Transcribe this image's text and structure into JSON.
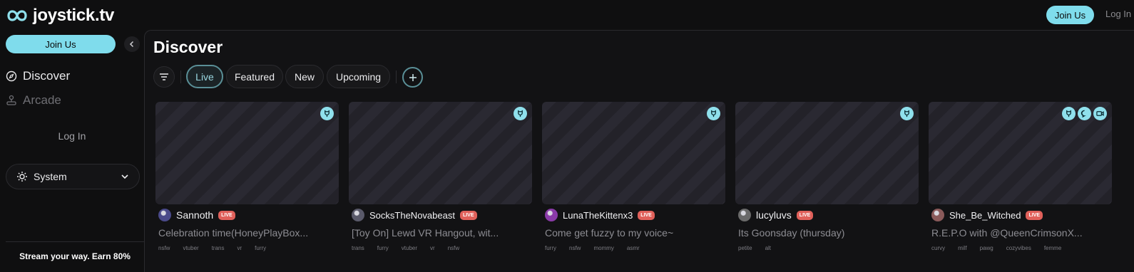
{
  "header": {
    "logo_text": "joystick.tv",
    "join_label": "Join Us",
    "login_label": "Log In"
  },
  "sidebar": {
    "join_label": "Join Us",
    "nav": [
      {
        "label": "Discover",
        "icon": "compass-icon"
      },
      {
        "label": "Arcade",
        "icon": "joystick-icon"
      }
    ],
    "login_label": "Log In",
    "theme_value": "System",
    "promo_text": "Stream your way. Earn 80%"
  },
  "main": {
    "title": "Discover",
    "tabs": [
      {
        "label": "Live",
        "active": true
      },
      {
        "label": "Featured",
        "active": false
      },
      {
        "label": "New",
        "active": false
      },
      {
        "label": "Upcoming",
        "active": false
      }
    ]
  },
  "streams": [
    {
      "name": "Sannoth",
      "live_label": "LIVE",
      "title": "Celebration time(HoneyPlayBox...",
      "tags": [
        "nsfw",
        "vtuber",
        "trans",
        "vr",
        "furry"
      ],
      "badges": [
        "toy-icon"
      ],
      "avatar_color": "#4a4a8a"
    },
    {
      "name": "SocksTheNovabeast",
      "live_label": "LIVE",
      "title": "[Toy On] Lewd VR Hangout, wit...",
      "tags": [
        "trans",
        "furry",
        "vtuber",
        "vr",
        "nsfw"
      ],
      "badges": [
        "toy-icon"
      ],
      "avatar_color": "#5a5a6a"
    },
    {
      "name": "LunaTheKittenx3",
      "live_label": "LIVE",
      "title": "Come get fuzzy to my voice~",
      "tags": [
        "furry",
        "nsfw",
        "mommy",
        "asmr"
      ],
      "badges": [
        "toy-icon"
      ],
      "avatar_color": "#8a3aa8"
    },
    {
      "name": "lucyluvs",
      "live_label": "LIVE",
      "title": "Its Goonsday (thursday)",
      "tags": [
        "petite",
        "alt"
      ],
      "badges": [
        "toy-icon"
      ],
      "avatar_color": "#6a6a6a"
    },
    {
      "name": "She_Be_Witched",
      "live_label": "LIVE",
      "title": "R.E.P.O with @QueenCrimsonX...",
      "tags": [
        "curvy",
        "milf",
        "pawg",
        "cozyvibes",
        "femme"
      ],
      "badges": [
        "toy-icon",
        "chat-icon",
        "video-icon"
      ],
      "avatar_color": "#8a5a5a"
    }
  ]
}
